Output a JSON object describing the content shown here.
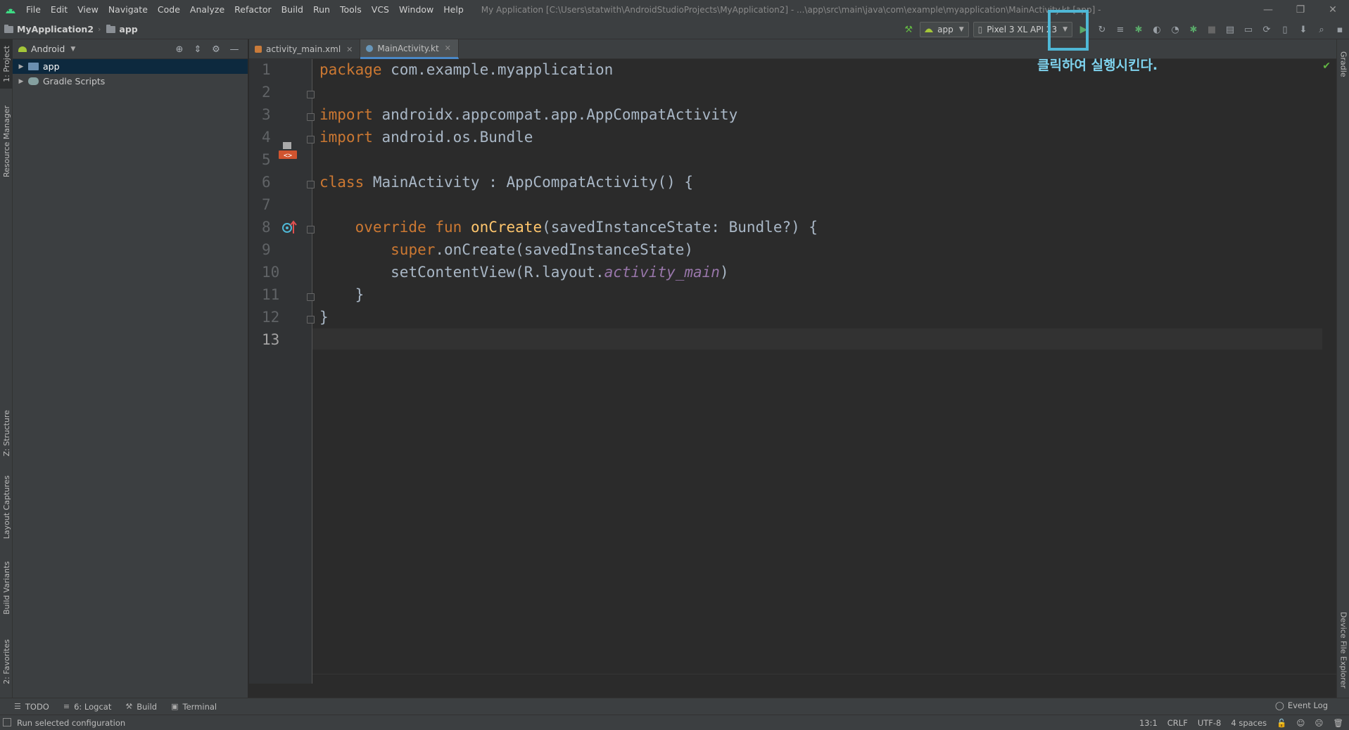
{
  "menu": {
    "items": [
      "File",
      "Edit",
      "View",
      "Navigate",
      "Code",
      "Analyze",
      "Refactor",
      "Build",
      "Run",
      "Tools",
      "VCS",
      "Window",
      "Help"
    ],
    "window_title": "My Application [C:\\Users\\statwith\\AndroidStudioProjects\\MyApplication2] - ...\\app\\src\\main\\java\\com\\example\\myapplication\\MainActivity.kt [app] - Android Studio"
  },
  "breadcrumb": {
    "project": "MyApplication2",
    "module": "app"
  },
  "toolbar": {
    "run_config": "app",
    "device": "Pixel 3 XL API 23"
  },
  "callout": {
    "text": "클릭하여 실행시킨다."
  },
  "project_panel": {
    "view_selector": "Android",
    "tree": [
      {
        "label": "app",
        "selected": true
      },
      {
        "label": "Gradle Scripts",
        "selected": false
      }
    ]
  },
  "left_tool_tabs": [
    "1: Project",
    "Resource Manager",
    "Z: Structure",
    "Layout Captures",
    "Build Variants",
    "2: Favorites"
  ],
  "right_tool_tabs": [
    "Gradle",
    "Device File Explorer"
  ],
  "tabs": [
    {
      "label": "activity_main.xml",
      "active": false
    },
    {
      "label": "MainActivity.kt",
      "active": true
    }
  ],
  "editor": {
    "line_numbers": [
      "1",
      "2",
      "3",
      "4",
      "5",
      "6",
      "7",
      "8",
      "9",
      "10",
      "11",
      "12",
      "13"
    ],
    "current_line": "13",
    "tokens": {
      "l1_kw": "package",
      "l1_rest": " com.example.myapplication",
      "l3_kw": "import",
      "l3_rest": " androidx.appcompat.app.AppCompatActivity",
      "l4_kw": "import",
      "l4_rest": " android.os.Bundle",
      "l6_kw": "class",
      "l6_rest": " MainActivity : AppCompatActivity() {",
      "l8_kw": "override fun",
      "l8_fn": "onCreate",
      "l8_rest": "(savedInstanceState: Bundle?) {",
      "l9_kw": "super",
      "l9_rest": ".onCreate(savedInstanceState)",
      "l10_pre": "setContentView(R.layout.",
      "l10_it": "activity_main",
      "l10_post": ")",
      "l11": "}",
      "l12": "}"
    }
  },
  "bottom_tools": [
    "TODO",
    "6: Logcat",
    "Build",
    "Terminal"
  ],
  "event_log": "Event Log",
  "status": {
    "message": "Run selected configuration",
    "position": "13:1",
    "line_sep": "CRLF",
    "encoding": "UTF-8",
    "indent": "4 spaces"
  }
}
